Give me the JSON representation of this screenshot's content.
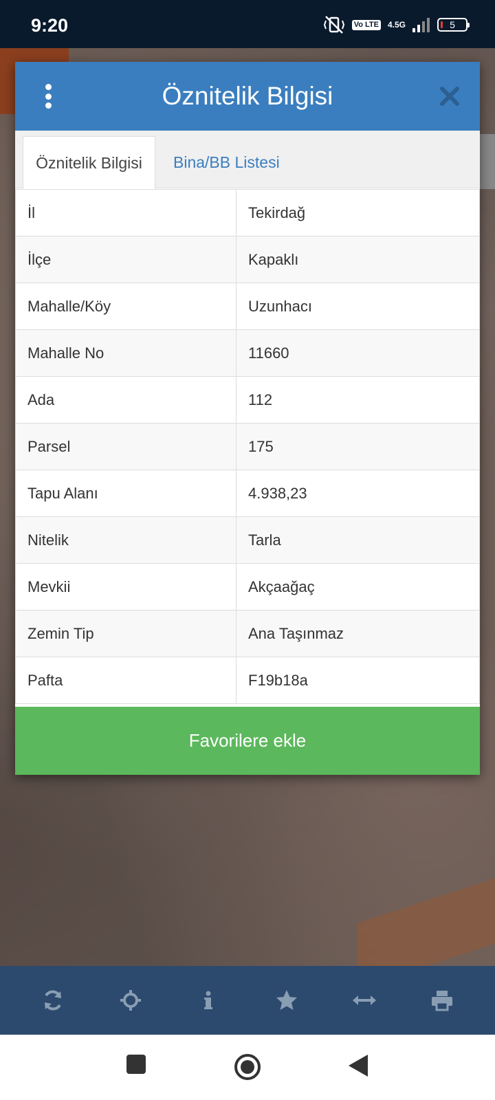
{
  "status_bar": {
    "time": "9:20",
    "volte_badge": "Vo LTE",
    "network": "4.5G",
    "battery_level": "5"
  },
  "modal": {
    "title": "Öznitelik Bilgisi",
    "tabs": [
      {
        "label": "Öznitelik Bilgisi",
        "active": true
      },
      {
        "label": "Bina/BB Listesi",
        "active": false
      }
    ],
    "rows": [
      {
        "key": "İl",
        "value": "Tekirdağ"
      },
      {
        "key": "İlçe",
        "value": "Kapaklı"
      },
      {
        "key": "Mahalle/Köy",
        "value": "Uzunhacı"
      },
      {
        "key": "Mahalle No",
        "value": "11660"
      },
      {
        "key": "Ada",
        "value": "112"
      },
      {
        "key": "Parsel",
        "value": "175"
      },
      {
        "key": "Tapu Alanı",
        "value": "4.938,23"
      },
      {
        "key": "Nitelik",
        "value": "Tarla"
      },
      {
        "key": "Mevkii",
        "value": "Akçaağaç"
      },
      {
        "key": "Zemin Tip",
        "value": "Ana Taşınmaz"
      },
      {
        "key": "Pafta",
        "value": "F19b18a"
      }
    ],
    "favorite_button": "Favorilere ekle"
  },
  "toolbar": {
    "icons": [
      "refresh-icon",
      "crosshair-icon",
      "info-icon",
      "star-icon",
      "measure-icon",
      "print-icon"
    ]
  },
  "colors": {
    "header": "#3a7ebf",
    "favorite": "#5cb85c",
    "toolbar": "#2c4a6e",
    "toolbar_icon": "#8a9eb3"
  }
}
